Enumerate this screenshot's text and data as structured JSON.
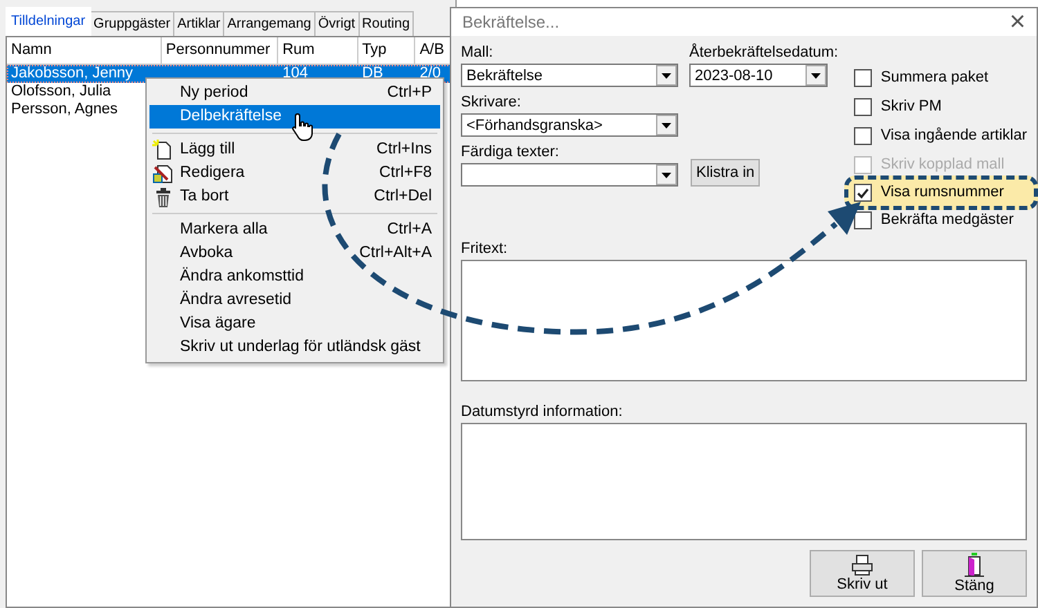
{
  "tabs": [
    {
      "label": "Tilldelningar",
      "selected": true
    },
    {
      "label": "Gruppgäster",
      "selected": false
    },
    {
      "label": "Artiklar",
      "selected": false
    },
    {
      "label": "Arrangemang",
      "selected": false
    },
    {
      "label": "Övrigt",
      "selected": false
    },
    {
      "label": "Routing",
      "selected": false
    }
  ],
  "table": {
    "columns": [
      "Namn",
      "Personnummer",
      "Rum",
      "Typ",
      "A/B"
    ],
    "rows": [
      {
        "cells": [
          "Jakobsson, Jenny",
          "",
          "104",
          "DB",
          "2/0"
        ],
        "selected": true
      },
      {
        "cells": [
          "Olofsson, Julia",
          "",
          "",
          "",
          ""
        ],
        "selected": false
      },
      {
        "cells": [
          "Persson, Agnes",
          "",
          "",
          "",
          ""
        ],
        "selected": false
      }
    ]
  },
  "context_menu": [
    {
      "kind": "item",
      "label": "Ny period",
      "shortcut": "Ctrl+P",
      "selected": false
    },
    {
      "kind": "item",
      "label": "Delbekräftelse",
      "selected": true
    },
    {
      "kind": "separator"
    },
    {
      "kind": "add",
      "label": "Lägg till",
      "shortcut": "Ctrl+Ins",
      "selected": false
    },
    {
      "kind": "edit",
      "label": "Redigera",
      "shortcut": "Ctrl+F8",
      "selected": false
    },
    {
      "kind": "delete",
      "label": "Ta bort",
      "shortcut": "Ctrl+Del",
      "selected": false
    },
    {
      "kind": "separator"
    },
    {
      "kind": "item",
      "label": "Markera alla",
      "shortcut": "Ctrl+A",
      "selected": false
    },
    {
      "kind": "item",
      "label": "Avboka",
      "shortcut": "Ctrl+Alt+A",
      "selected": false
    },
    {
      "kind": "item",
      "label": "Ändra ankomsttid",
      "selected": false
    },
    {
      "kind": "item",
      "label": "Ändra avresetid",
      "selected": false
    },
    {
      "kind": "item",
      "label": "Visa ägare",
      "selected": false
    },
    {
      "kind": "item",
      "label": "Skriv ut underlag för utländsk gäst",
      "selected": false
    }
  ],
  "dialog": {
    "title": "Bekräftelse...",
    "close": "×",
    "mall": {
      "label": "Mall:",
      "value": "Bekräftelse"
    },
    "date": {
      "label": "Återbekräftelsedatum:",
      "value": "2023-08-10"
    },
    "printer": {
      "label": "Skrivare:",
      "value": "<Förhandsgranska>"
    },
    "texts": {
      "label": "Färdiga texter:",
      "button": "Klistra in"
    },
    "checkboxes": [
      {
        "label": "Summera paket",
        "checked": false,
        "disabled": false,
        "highlighted": false
      },
      {
        "label": "Skriv PM",
        "checked": false,
        "disabled": false,
        "highlighted": false
      },
      {
        "label": "Visa ingående artiklar",
        "checked": false,
        "disabled": false,
        "highlighted": false
      },
      {
        "label": "Skriv kopplad mall",
        "checked": false,
        "disabled": true,
        "highlighted": false
      },
      {
        "label": "Visa rumsnummer",
        "checked": true,
        "disabled": false,
        "highlighted": true
      },
      {
        "label": "Bekräfta medgäster",
        "checked": false,
        "disabled": false,
        "highlighted": false
      }
    ],
    "fritext_label": "Fritext:",
    "dated_label": "Datumstyrd information:",
    "buttons": [
      {
        "kind": "print",
        "label": "Skriv ut"
      },
      {
        "kind": "close",
        "label": "Stäng"
      }
    ]
  }
}
